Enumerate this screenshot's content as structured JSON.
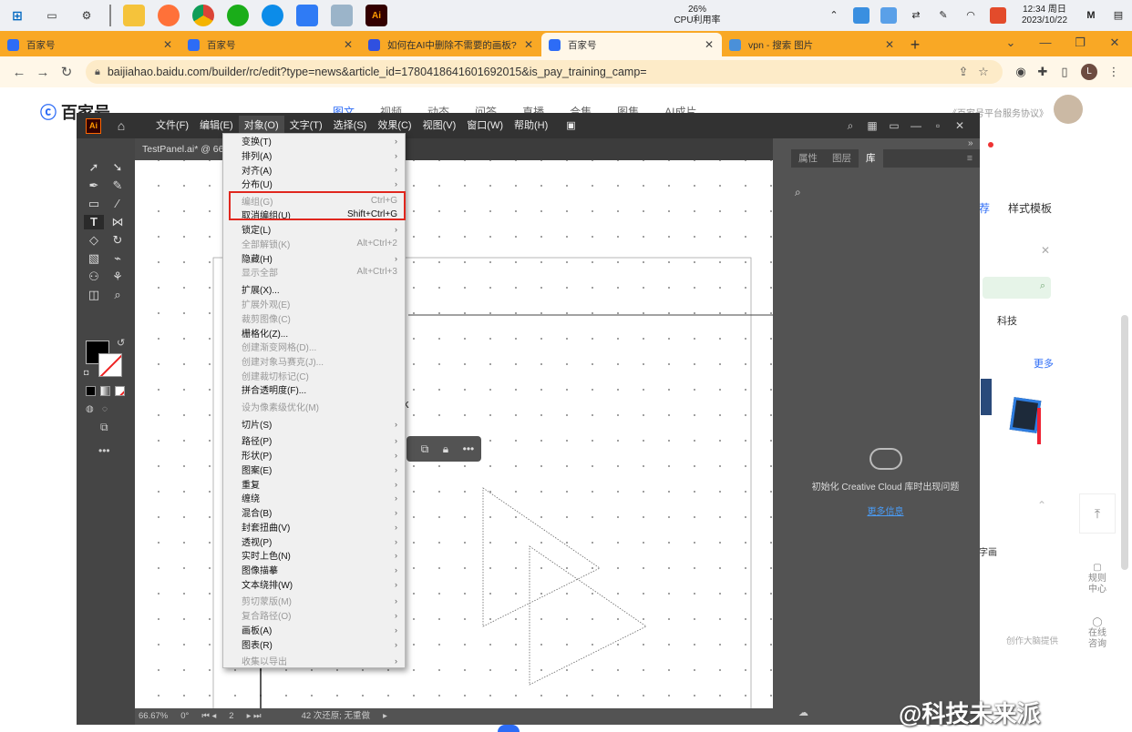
{
  "taskbar": {
    "cpu_percent": "26%",
    "cpu_label": "CPU利用率",
    "time": "12:34 周日",
    "date": "2023/10/22",
    "apps": [
      "start",
      "task-view",
      "settings",
      "file-explorer",
      "firefox",
      "chrome",
      "wechat",
      "edge",
      "app-blue",
      "app-gray",
      "illustrator"
    ]
  },
  "tabs": [
    {
      "label": "百家号",
      "active": false
    },
    {
      "label": "百家号",
      "active": false
    },
    {
      "label": "如何在AI中删除不需要的画板?",
      "active": false
    },
    {
      "label": "百家号",
      "active": true
    },
    {
      "label": "vpn - 搜索 图片",
      "active": false
    }
  ],
  "address": {
    "url": "baijiahao.baidu.com/builder/rc/edit?type=news&article_id=1780418641601692015&is_pay_training_camp=",
    "avatar_letter": "L"
  },
  "page": {
    "logo": "百家号",
    "nav": [
      "图文",
      "视频",
      "动态",
      "问答",
      "直播",
      "合集",
      "图集",
      "AI成片"
    ],
    "protocol": "《百家号平台服务协议》",
    "right_items": {
      "style_tab": "样式模板",
      "tab_partial": "荐",
      "category": "科技",
      "more": "更多",
      "word_art": "字画",
      "provider": "创作大脑提供"
    },
    "side_tools": [
      {
        "label": "规则中心"
      },
      {
        "label": "在线咨询"
      }
    ]
  },
  "ai": {
    "menus": [
      "文件(F)",
      "编辑(E)",
      "对象(O)",
      "文字(T)",
      "选择(S)",
      "效果(C)",
      "视图(V)",
      "窗口(W)",
      "帮助(H)"
    ],
    "doc_tab": "TestPanel.ai* @ 66",
    "status": {
      "zoom": "66.67%",
      "angle": "0°",
      "artboard": "2",
      "undo": "42 次还原; 无重做"
    },
    "panel_tabs": [
      "属性",
      "图层",
      "库"
    ],
    "cc_message": "初始化 Creative Cloud 库时出现问题",
    "cc_link": "更多信息",
    "canvas_text_fragment": "k",
    "object_menu": [
      {
        "label": "变换(T)",
        "shortcut": "",
        "submenu": true,
        "disabled": false
      },
      {
        "label": "排列(A)",
        "shortcut": "",
        "submenu": true,
        "disabled": false
      },
      {
        "label": "对齐(A)",
        "shortcut": "",
        "submenu": true,
        "disabled": false
      },
      {
        "label": "分布(U)",
        "shortcut": "",
        "submenu": true,
        "disabled": false
      },
      {
        "label": "编组(G)",
        "shortcut": "Ctrl+G",
        "submenu": false,
        "disabled": true
      },
      {
        "label": "取消编组(U)",
        "shortcut": "Shift+Ctrl+G",
        "submenu": false,
        "disabled": false
      },
      {
        "label": "锁定(L)",
        "shortcut": "",
        "submenu": true,
        "disabled": false
      },
      {
        "label": "全部解锁(K)",
        "shortcut": "Alt+Ctrl+2",
        "submenu": false,
        "disabled": true
      },
      {
        "label": "隐藏(H)",
        "shortcut": "",
        "submenu": true,
        "disabled": false
      },
      {
        "label": "显示全部",
        "shortcut": "Alt+Ctrl+3",
        "submenu": false,
        "disabled": true
      },
      {
        "label": "扩展(X)...",
        "shortcut": "",
        "submenu": false,
        "disabled": false
      },
      {
        "label": "扩展外观(E)",
        "shortcut": "",
        "submenu": false,
        "disabled": true
      },
      {
        "label": "裁剪图像(C)",
        "shortcut": "",
        "submenu": false,
        "disabled": true
      },
      {
        "label": "栅格化(Z)...",
        "shortcut": "",
        "submenu": false,
        "disabled": false
      },
      {
        "label": "创建渐变网格(D)...",
        "shortcut": "",
        "submenu": false,
        "disabled": true
      },
      {
        "label": "创建对象马赛克(J)...",
        "shortcut": "",
        "submenu": false,
        "disabled": true
      },
      {
        "label": "创建裁切标记(C)",
        "shortcut": "",
        "submenu": false,
        "disabled": true
      },
      {
        "label": "拼合透明度(F)...",
        "shortcut": "",
        "submenu": false,
        "disabled": false
      },
      {
        "label": "设为像素级优化(M)",
        "shortcut": "",
        "submenu": false,
        "disabled": true
      },
      {
        "label": "切片(S)",
        "shortcut": "",
        "submenu": true,
        "disabled": false
      },
      {
        "label": "路径(P)",
        "shortcut": "",
        "submenu": true,
        "disabled": false
      },
      {
        "label": "形状(P)",
        "shortcut": "",
        "submenu": true,
        "disabled": false
      },
      {
        "label": "图案(E)",
        "shortcut": "",
        "submenu": true,
        "disabled": false
      },
      {
        "label": "重复",
        "shortcut": "",
        "submenu": true,
        "disabled": false
      },
      {
        "label": "缠绕",
        "shortcut": "",
        "submenu": true,
        "disabled": false
      },
      {
        "label": "混合(B)",
        "shortcut": "",
        "submenu": true,
        "disabled": false
      },
      {
        "label": "封套扭曲(V)",
        "shortcut": "",
        "submenu": true,
        "disabled": false
      },
      {
        "label": "透视(P)",
        "shortcut": "",
        "submenu": true,
        "disabled": false
      },
      {
        "label": "实时上色(N)",
        "shortcut": "",
        "submenu": true,
        "disabled": false
      },
      {
        "label": "图像描摹",
        "shortcut": "",
        "submenu": true,
        "disabled": false
      },
      {
        "label": "文本绕排(W)",
        "shortcut": "",
        "submenu": true,
        "disabled": false
      },
      {
        "label": "剪切蒙版(M)",
        "shortcut": "",
        "submenu": true,
        "disabled": true
      },
      {
        "label": "复合路径(O)",
        "shortcut": "",
        "submenu": true,
        "disabled": true
      },
      {
        "label": "画板(A)",
        "shortcut": "",
        "submenu": true,
        "disabled": false
      },
      {
        "label": "图表(R)",
        "shortcut": "",
        "submenu": true,
        "disabled": false
      },
      {
        "label": "收集以导出",
        "shortcut": "",
        "submenu": true,
        "disabled": true
      }
    ]
  },
  "watermark": "@科技未来派",
  "colors": {
    "tab_bar": "#f9a825",
    "ai_dark": "#323232",
    "highlight": "#e0271e",
    "link": "#4a9cf6"
  }
}
